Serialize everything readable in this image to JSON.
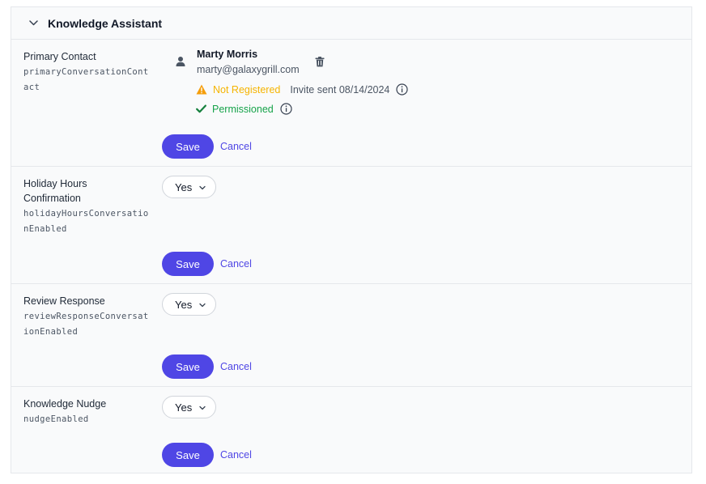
{
  "panel": {
    "title": "Knowledge Assistant"
  },
  "colors": {
    "accent": "#4f46e5",
    "warning": "#f5b400",
    "success": "#16a34a",
    "panel_bg": "#f9fafb"
  },
  "icons": [
    "chevron-down-icon",
    "user-icon",
    "trash-icon",
    "warning-icon",
    "info-icon",
    "check-icon"
  ],
  "primary_contact": {
    "label": "Primary Contact",
    "key": "primaryConversationContact",
    "name": "Marty Morris",
    "email": "marty@galaxygrill.com",
    "registration_status": "Not Registered",
    "invite_text": "Invite sent 08/14/2024",
    "permission_status": "Permissioned",
    "save_label": "Save",
    "cancel_label": "Cancel"
  },
  "holiday_hours": {
    "label": "Holiday Hours Confirmation",
    "key": "holidayHoursConversationEnabled",
    "value": "Yes",
    "save_label": "Save",
    "cancel_label": "Cancel"
  },
  "review_response": {
    "label": "Review Response",
    "key": "reviewResponseConversationEnabled",
    "value": "Yes",
    "save_label": "Save",
    "cancel_label": "Cancel"
  },
  "knowledge_nudge": {
    "label": "Knowledge Nudge",
    "key": "nudgeEnabled",
    "value": "Yes",
    "save_label": "Save",
    "cancel_label": "Cancel"
  }
}
